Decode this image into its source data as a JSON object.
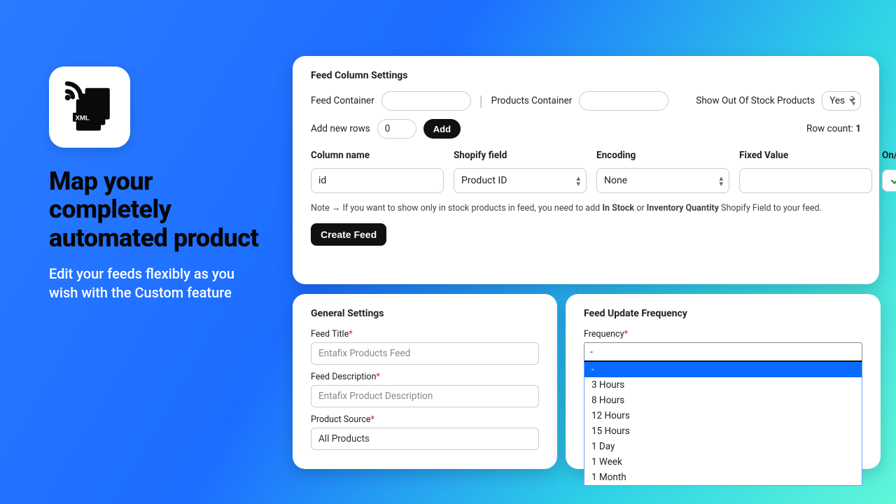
{
  "promo": {
    "headline": "Map your completely automated product",
    "subline": "Edit your feeds flexibly as you wish with the Custom feature",
    "icon_badge_text": "XML"
  },
  "top": {
    "title": "Feed Column Settings",
    "feed_container_label": "Feed Container",
    "feed_container_value": "",
    "products_container_label": "Products Container",
    "products_container_value": "",
    "oos_label": "Show Out Of Stock Products",
    "oos_value": "Yes",
    "add_rows_label": "Add new rows",
    "add_rows_value": "0",
    "add_button": "Add",
    "row_count_label": "Row count:",
    "row_count_value": "1",
    "headers": {
      "col": "Column name",
      "field": "Shopify field",
      "enc": "Encoding",
      "fixed": "Fixed Value",
      "onoff": "On/Off"
    },
    "row1": {
      "col": "id",
      "field": "Product ID",
      "enc": "None",
      "fixed": "",
      "on": true
    },
    "note_prefix": "Note ",
    "note_arrow": "→",
    "note_text_a": " If you want to show only in stock products in feed, you need to add ",
    "note_bold_a": "In Stock",
    "note_or": " or ",
    "note_bold_b": "Inventory Quantity",
    "note_text_b": " Shopify Field to your feed.",
    "create_button": "Create Feed"
  },
  "general": {
    "title": "General Settings",
    "feed_title_label": "Feed Title",
    "feed_title_placeholder": "Entafix Products Feed",
    "feed_desc_label": "Feed Description",
    "feed_desc_placeholder": "Entafix Product Description",
    "product_source_label": "Product Source",
    "product_source_value": "All Products"
  },
  "frequency": {
    "title": "Feed Update Frequency",
    "label": "Frequency",
    "value": "-",
    "options": [
      "-",
      "3 Hours",
      "8 Hours",
      "12 Hours",
      "15 Hours",
      "1 Day",
      "1 Week",
      "1 Month"
    ]
  }
}
